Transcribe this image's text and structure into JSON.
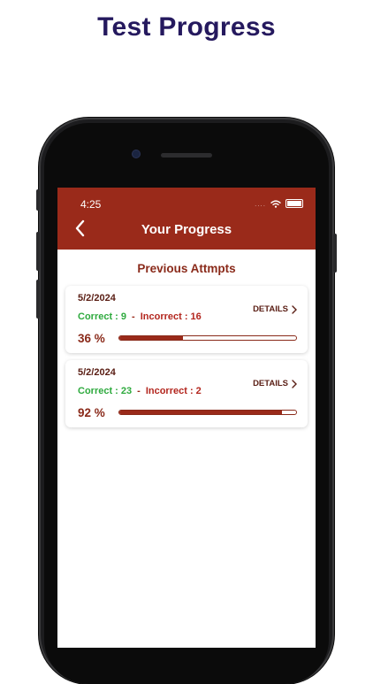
{
  "headline": "Test Progress",
  "status_bar": {
    "time": "4:25",
    "signal": "....",
    "icons": [
      "wifi-icon",
      "battery-icon"
    ]
  },
  "app_bar": {
    "title": "Your Progress",
    "back_icon": "chevron-left-icon"
  },
  "section_title": "Previous Attmpts",
  "attempts": [
    {
      "date": "5/2/2024",
      "correct_text": "Correct : 9",
      "separator": "-",
      "incorrect_text": "Incorrect : 16",
      "details_label": "DETAILS",
      "percent_text": "36 %",
      "progress": 36
    },
    {
      "date": "5/2/2024",
      "correct_text": "Correct : 23",
      "separator": "-",
      "incorrect_text": "Incorrect : 2",
      "details_label": "DETAILS",
      "percent_text": "92 %",
      "progress": 92
    }
  ],
  "colors": {
    "headline": "#25195e",
    "app_bar": "#9a2a1a",
    "correct": "#2eaa3e",
    "incorrect": "#b3261e",
    "accent_text": "#8a2a1a"
  }
}
